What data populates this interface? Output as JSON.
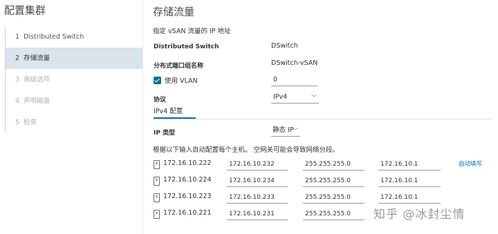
{
  "sidebar": {
    "title": "配置集群",
    "steps": [
      {
        "num": "1",
        "label": "Distributed Switch"
      },
      {
        "num": "2",
        "label": "存储流量"
      },
      {
        "num": "3",
        "label": "高级选项"
      },
      {
        "num": "4",
        "label": "声明磁盘"
      },
      {
        "num": "5",
        "label": "检查"
      }
    ]
  },
  "main": {
    "title": "存储流量",
    "subtitle": "指定 vSAN 流量的 IP 地址",
    "distributed_switch": {
      "label": "Distributed Switch",
      "value": "DSwitch"
    },
    "port_group": {
      "label": "分布式端口组名称",
      "value": "DSwitch-vSAN"
    },
    "vlan": {
      "label": "使用 VLAN",
      "checked": true,
      "value": "0"
    },
    "protocol": {
      "label": "协议",
      "value": "IPv4"
    },
    "tab_label": "IPv4 配置",
    "ip_type": {
      "label": "IP 类型",
      "value": "静态 IP"
    },
    "hint": "根据以下输入自动配置每个主机。 空网关可能会导致网络分段。",
    "autofill_label": "自动填写",
    "hosts": [
      {
        "name": "172.16.10.222",
        "ip": "172.16.10.232",
        "mask": "255.255.255.0",
        "gateway": "172.16.10.1"
      },
      {
        "name": "172.16.10.224",
        "ip": "172.16.10.234",
        "mask": "255.255.255.0",
        "gateway": "172.16.10.1"
      },
      {
        "name": "172.16.10.223",
        "ip": "172.16.10.233",
        "mask": "255.255.255.0",
        "gateway": "172.16.10.1"
      },
      {
        "name": "172.16.10.221",
        "ip": "172.16.10.231",
        "mask": "255.255.255.0",
        "gateway": ""
      }
    ]
  },
  "watermark": "知乎 @冰封尘情",
  "colors": {
    "accent": "#0072a3",
    "active_step_bg": "#d9e4ec"
  }
}
